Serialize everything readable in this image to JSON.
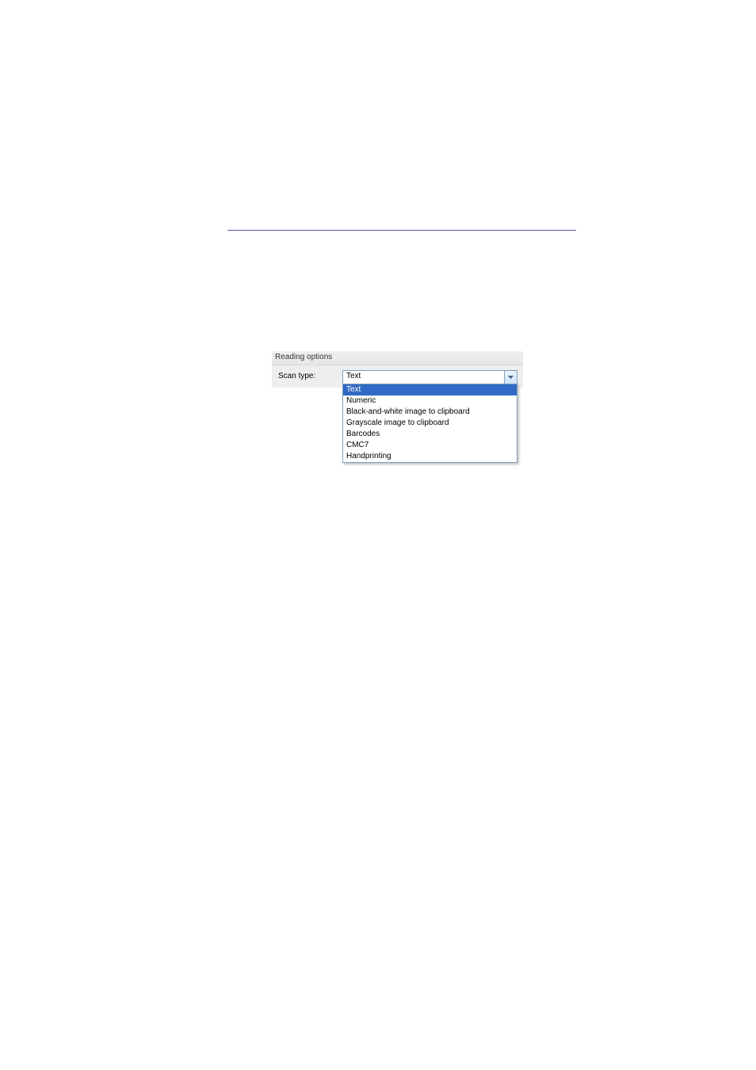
{
  "dialog": {
    "section_title": "Reading options",
    "scan_type": {
      "label": "Scan type:",
      "selected": "Text",
      "options": [
        "Text",
        "Numeric",
        "Black-and-white image to clipboard",
        "Grayscale image to clipboard",
        "Barcodes",
        "CMC7",
        "Handprinting"
      ],
      "highlighted_index": 0
    }
  }
}
